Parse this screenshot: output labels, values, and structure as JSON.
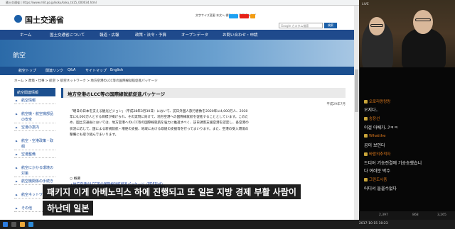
{
  "browser": {
    "url": "國土交通省 | https://www.mlit.go.jp/koku/koku_tk15_000034.html",
    "toplinks": "文字サイズ変更  本文へ  標準  拡大  音声読み上げ",
    "sns": [
      {
        "name": "twitter-icon",
        "color": "#1da1f2"
      },
      {
        "name": "youtube-icon",
        "color": "#e62117"
      },
      {
        "name": "rss-icon",
        "color": "#f39c12"
      }
    ],
    "search_placeholder": "Google カスタム検索",
    "search_button": "検索"
  },
  "site": {
    "title": "国土交通省",
    "nav": [
      "ホーム",
      "国土交通省について",
      "報道・広報",
      "政策・法令・予算",
      "オープンデータ",
      "お問い合わせ・申請"
    ],
    "banner_title": "航空",
    "subnav": [
      "航空トップ",
      "関連リンク",
      "Q&A",
      "サイトマップ",
      "English"
    ],
    "breadcrumb": "ホーム > 政策・仕事 > 航空 > 航空ネットワーク > 地方空港のLCC等の国際線就航促進パッケージ"
  },
  "sidebar": {
    "heading": "航空関連情報",
    "items": [
      "航空情報",
      "航空機・航空機部品の安全",
      "空港の案内",
      "航空・空港政策・取組",
      "空港整備",
      "航空にかかる環境の対策",
      "航空機関係の手続き",
      "航空ネットワーク",
      "その他"
    ]
  },
  "content": {
    "title": "地方空港のLCC等の国際線就航促進パッケージ",
    "date": "平成29年7月",
    "paragraph": "「明日の日本を支える観光ビジョン」（平成28年3月30日）において、訪日外国人旅行者数を2020年に4,000万人、2030年に6,000万人とする目標が掲げられ、その実現に向けて、地方空港への国際線就航を促進することとしています。このため、国土交通省においては、地方空港へのLCC等の国際線就航を強力に推進すべく、訪日誘客支援空港を認定し、各空港の状況に応じて、国による新規就航・増便の支援、地域における取組の支援等を行ってまいります。また、空港の受入環境の整備にも取り組んでまいります。",
    "overview": "○ 概要",
    "pdf_link": "・地方空港のLCC等の国際線就航促進パッケージ（PDF形式）"
  },
  "taskbar": {
    "status": "2017-10-15 10:23"
  },
  "webcam": {
    "label": "LIVE"
  },
  "chat": {
    "messages": [
      {
        "nick": "오로라랑랑랑",
        "text": "오지다.."
      },
      {
        "nick": "송장선",
        "text": "이걸 아베가..?ㅋㅋ"
      },
      {
        "nick": "Whatthe",
        "text": "곰이 보인다"
      },
      {
        "nick": "바람의추적자",
        "text": "드디어 기승전결에 기승승했습니"
      },
      {
        "nick": "",
        "text": "다 여러분 박수"
      },
      {
        "nick": "그린도시즘",
        "text": "어디서 들을수없다"
      }
    ]
  },
  "stats": {
    "viewers": "2,397",
    "likes": "868",
    "followers": "3,265"
  },
  "subtitles": {
    "line1": "패키지 이게 아베노믹스 하에 진행되고 또 일본 지방 경제 부활 사람이",
    "line2": "하난데 일본"
  }
}
